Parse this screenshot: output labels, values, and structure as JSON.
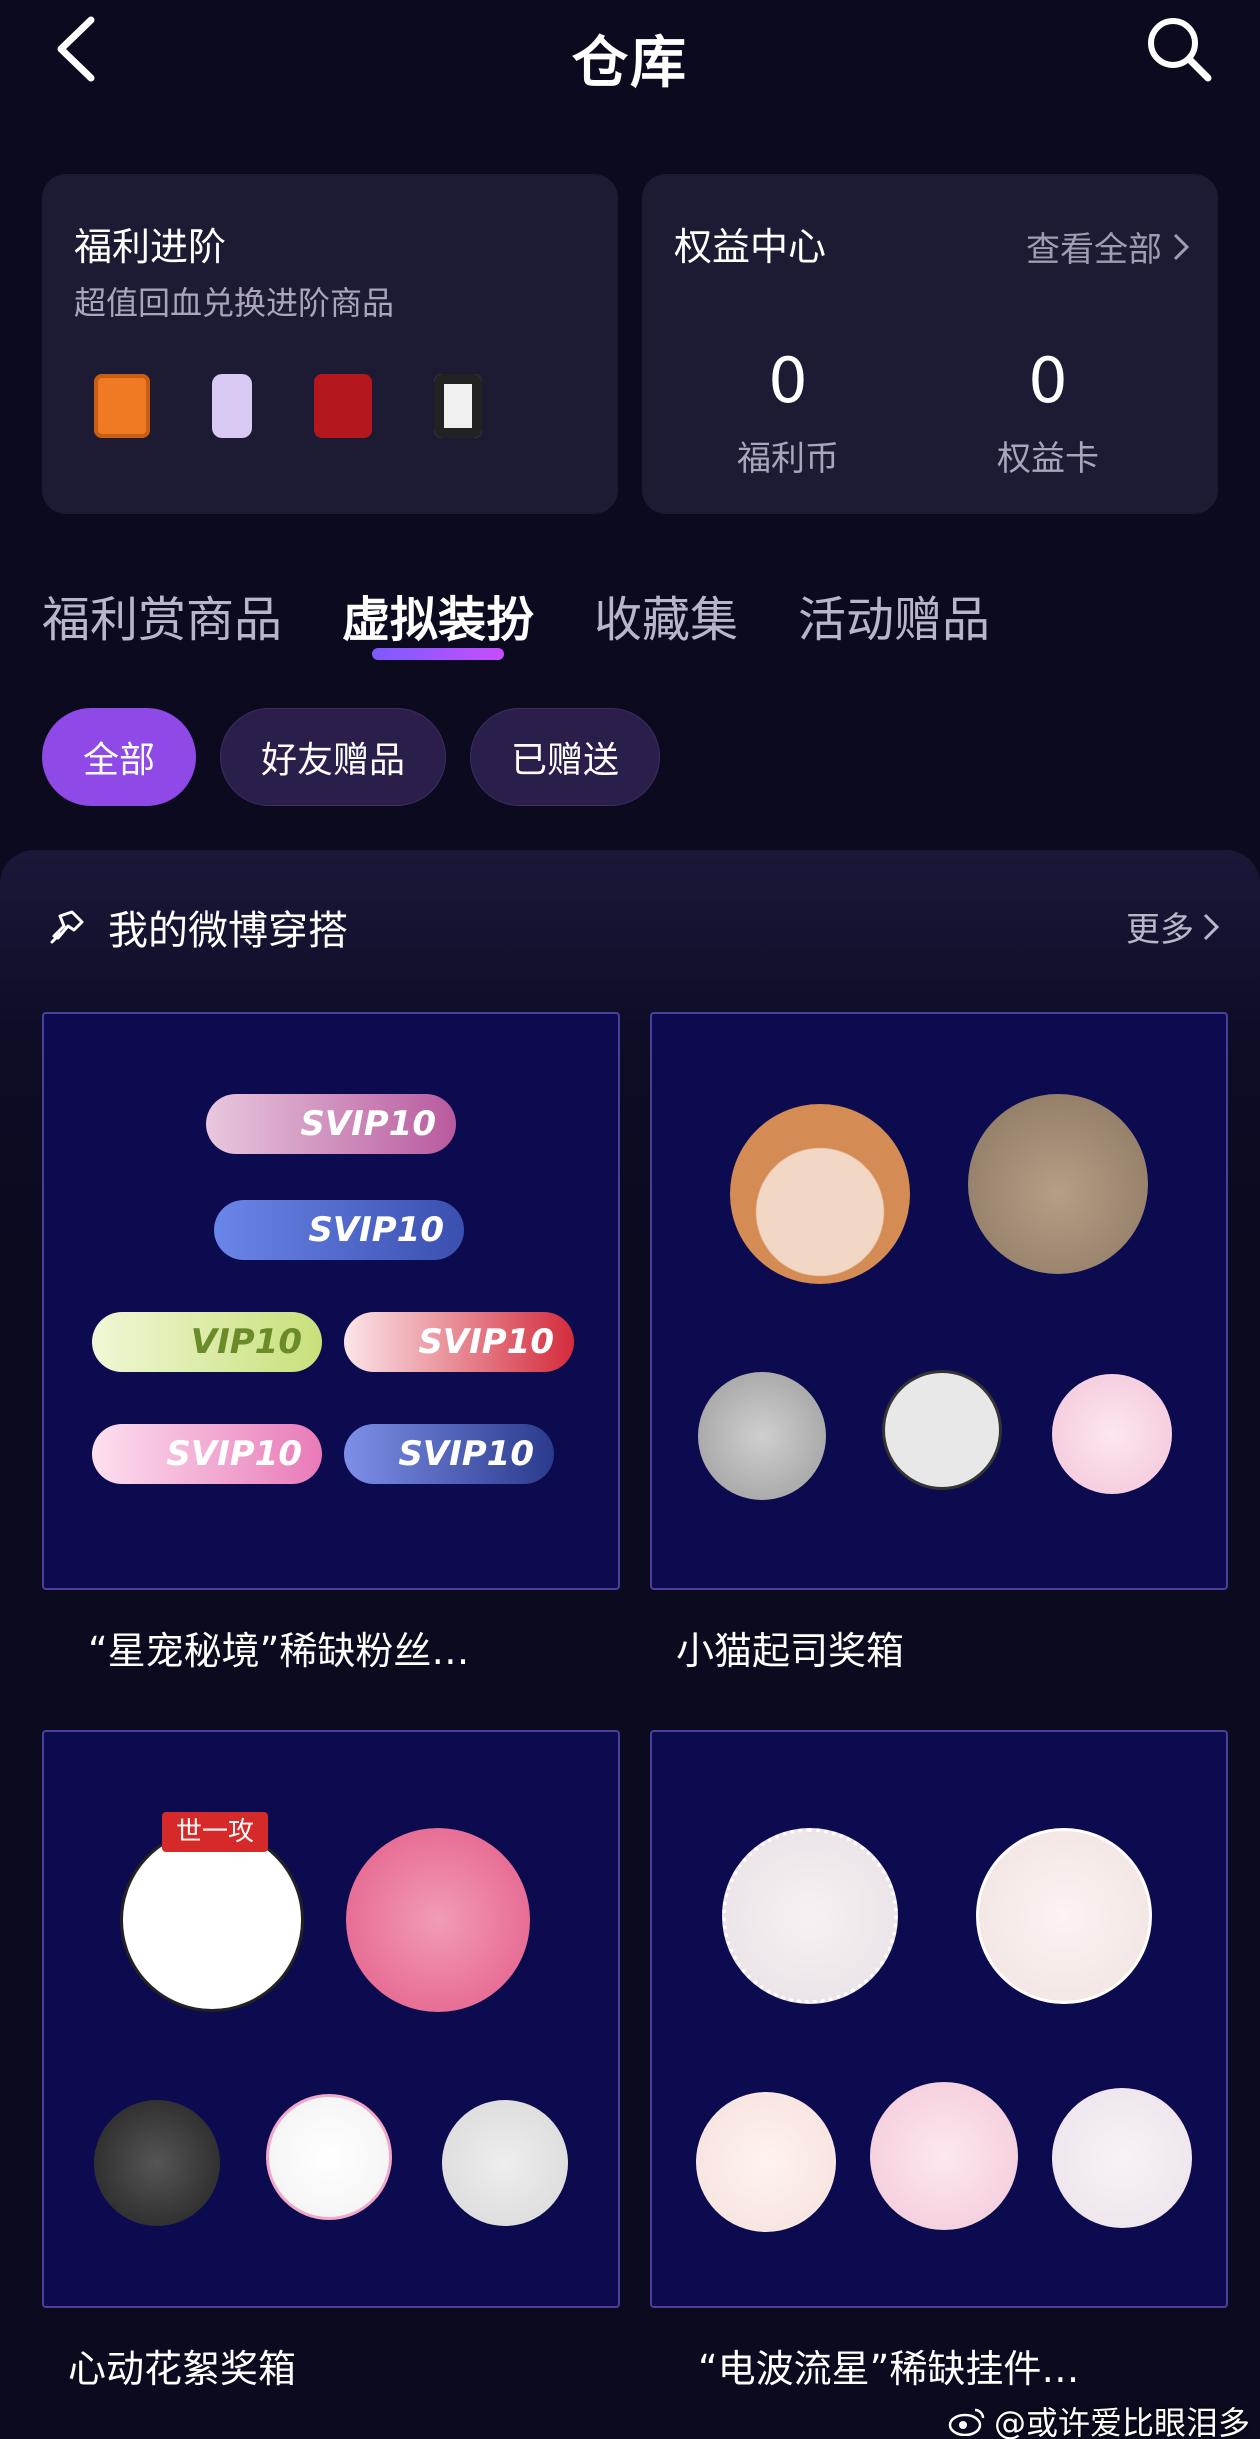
{
  "header": {
    "title": "仓库"
  },
  "welfare_card": {
    "title": "福利进阶",
    "subtitle": "超值回血兑换进阶商品",
    "phone_colors": [
      "#f07a24",
      "#d8c9f2",
      "#b3161b",
      "#f0f0f0"
    ]
  },
  "rights_card": {
    "title": "权益中心",
    "view_all": "查看全部",
    "stats": [
      {
        "value": "0",
        "label": "福利币"
      },
      {
        "value": "0",
        "label": "权益卡"
      }
    ]
  },
  "tabs": [
    {
      "label": "福利赏商品",
      "active": false
    },
    {
      "label": "虚拟装扮",
      "active": true
    },
    {
      "label": "收藏集",
      "active": false
    },
    {
      "label": "活动赠品",
      "active": false
    }
  ],
  "chips": [
    {
      "label": "全部",
      "active": true
    },
    {
      "label": "好友赠品",
      "active": false
    },
    {
      "label": "已赠送",
      "active": false
    }
  ],
  "section": {
    "title": "我的微博穿搭",
    "more": "更多"
  },
  "items": [
    {
      "label": "“星宠秘境”稀缺粉丝…",
      "badges": [
        {
          "text": "SVIP10",
          "color": "#b85a9e"
        },
        {
          "text": "SVIP10",
          "color": "#3a4fb0"
        },
        {
          "text": "VIP10",
          "color": "#c8e07a"
        },
        {
          "text": "SVIP10",
          "color": "#d42c3c"
        },
        {
          "text": "SVIP10",
          "color": "#e87ab8"
        },
        {
          "text": "SVIP10",
          "color": "#2a3a8c"
        }
      ]
    },
    {
      "label": "小猫起司奖箱",
      "avatar_colors": [
        "#d58b54",
        "#8a7560",
        "#9c9c9c",
        "#e8e8e8",
        "#f2c4d8"
      ]
    },
    {
      "label": "心动花絮奖箱",
      "tag": "世一攻",
      "avatar_colors": [
        "#ffffff",
        "#e35b87",
        "#222222",
        "#f2f2f2",
        "#d8d8d8"
      ]
    },
    {
      "label": "“电波流星”稀缺挂件…",
      "avatar_colors": [
        "#e8e0e4",
        "#efe2e0",
        "#f5e0dc",
        "#f2c8d8",
        "#ece2ea"
      ]
    }
  ],
  "watermark": "@或许爱比眼泪多"
}
